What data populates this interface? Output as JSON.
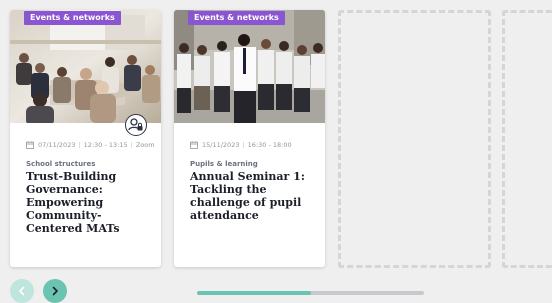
{
  "colors": {
    "badge": "#8a55d0",
    "accent": "#6bc4b1",
    "accent_light": "#bfe5dd",
    "title": "#1c1f2a",
    "meta": "#9096a3",
    "placeholder_border": "#d4d5d7",
    "track": "#c8c9cc"
  },
  "cards": [
    {
      "badge": "Events & networks",
      "date": "07/11/2023",
      "time": "12:30 - 13:15",
      "location": "Zoom",
      "category": "School structures",
      "title": "Trust-Building Governance: Empowering Community-Centered MATs",
      "image_icon": "meeting-room-photo",
      "overlay_icon": "user-lock-icon"
    },
    {
      "badge": "Events & networks",
      "date": "15/11/2023",
      "time": "16:30 - 18:00",
      "category": "Pupils & learning",
      "title": "Annual Seminar 1: Tackling the challenge of pupil attendance",
      "image_icon": "students-group-photo"
    }
  ],
  "navigation": {
    "prev_icon": "chevron-left-icon",
    "next_icon": "chevron-right-icon"
  },
  "progress": {
    "fraction": 0.5
  }
}
